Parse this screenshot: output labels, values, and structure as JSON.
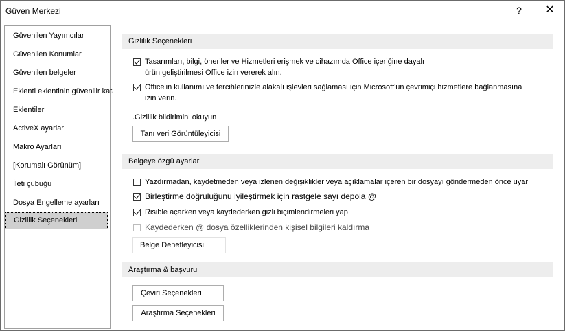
{
  "window": {
    "title": "Güven Merkezi",
    "help_label": "?",
    "close_label": "✕"
  },
  "nav": {
    "items": [
      "Güvenilen Yayımcılar",
      "Güvenilen Konumlar",
      "Güvenilen belgeler",
      "Eklenti eklentinin güvenilir katalogları",
      "Eklentiler",
      "ActiveX ayarları",
      "Makro Ayarları",
      "[Korumalı Görünüm]",
      "İleti çubuğu",
      "Dosya Engelleme ayarları",
      "Gizlilik Seçenekleri"
    ],
    "selected_index": 10
  },
  "privacy": {
    "heading": "Gizlilik Seçenekleri",
    "opt1_line1": "Tasarımları, bilgi, öneriler ve Hizmetleri erişmek ve cihazımda Office içeriğine dayalı",
    "opt1_line2": "ürün geliştirilmesi Office izin vererek alın.",
    "opt1_checked": true,
    "opt2_line1": "Office'in kullanımı ve tercihlerinizle alakalı işlevleri sağlaması için Microsoft'un çevrimiçi hizmetlere bağlanmasına",
    "opt2_line2": "izin verin.",
    "opt2_checked": true,
    "statement_link": ".Gizlilik bildirimini okuyun",
    "diag_button": "Tanı veri Görüntüleyicisi"
  },
  "document": {
    "heading": "Belgeye özgü ayarlar",
    "opt1": "Yazdırmadan, kaydetmeden veya izlenen değişiklikler veya açıklamalar içeren bir dosyayı göndermeden önce uyar",
    "opt1_checked": false,
    "opt2": "Birleştirme doğruluğunu iyileştirmek için rastgele sayı depola @",
    "opt2_checked": true,
    "opt3": "Risible açarken veya kaydederken gizli biçimlendirmeleri yap",
    "opt3_checked": true,
    "opt4": "Kaydederken @ dosya özelliklerinden kişisel bilgileri kaldırma",
    "opt4_checked": false,
    "opt4_disabled": true,
    "inspector_button": "Belge Denetleyicisi"
  },
  "research": {
    "heading": "Araştırma & başvuru",
    "translation_button": "Çeviri Seçenekleri",
    "research_button": "Araştırma Seçenekleri"
  }
}
